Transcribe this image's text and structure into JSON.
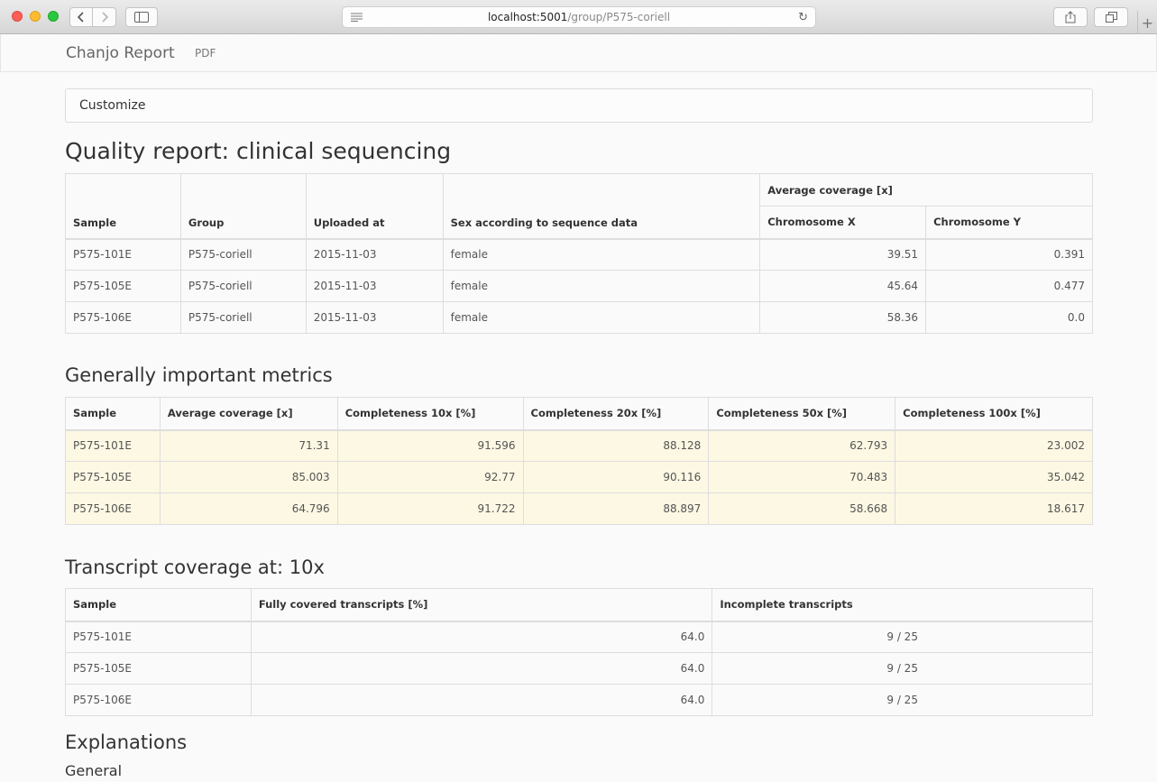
{
  "browser": {
    "address_host": "localhost:5001",
    "address_path": "/group/P575-coriell",
    "icons": [
      "back-icon",
      "forward-icon",
      "sidebar-icon",
      "reader-icon",
      "reload-icon",
      "share-icon",
      "tabs-icon",
      "plus-icon"
    ]
  },
  "navbar": {
    "brand": "Chanjo Report",
    "pdf_link": "PDF"
  },
  "customize": {
    "label": "Customize"
  },
  "quality": {
    "title": "Quality report: clinical sequencing",
    "group_header": "Average coverage [x]",
    "columns": [
      "Sample",
      "Group",
      "Uploaded at",
      "Sex according to sequence data",
      "Chromosome X",
      "Chromosome Y"
    ],
    "rows": [
      [
        "P575-101E",
        "P575-coriell",
        "2015-11-03",
        "female",
        "39.51",
        "0.391"
      ],
      [
        "P575-105E",
        "P575-coriell",
        "2015-11-03",
        "female",
        "45.64",
        "0.477"
      ],
      [
        "P575-106E",
        "P575-coriell",
        "2015-11-03",
        "female",
        "58.36",
        "0.0"
      ]
    ]
  },
  "metrics": {
    "title": "Generally important metrics",
    "columns": [
      "Sample",
      "Average coverage [x]",
      "Completeness 10x [%]",
      "Completeness 20x [%]",
      "Completeness 50x [%]",
      "Completeness 100x [%]"
    ],
    "rows": [
      [
        "P575-101E",
        "71.31",
        "91.596",
        "88.128",
        "62.793",
        "23.002"
      ],
      [
        "P575-105E",
        "85.003",
        "92.77",
        "90.116",
        "70.483",
        "35.042"
      ],
      [
        "P575-106E",
        "64.796",
        "91.722",
        "88.897",
        "58.668",
        "18.617"
      ]
    ],
    "highlight_color": "#fcf8e3"
  },
  "transcripts": {
    "title": "Transcript coverage at: 10x",
    "columns": [
      "Sample",
      "Fully covered transcripts [%]",
      "Incomplete transcripts"
    ],
    "rows": [
      [
        "P575-101E",
        "64.0",
        "9 / 25"
      ],
      [
        "P575-105E",
        "64.0",
        "9 / 25"
      ],
      [
        "P575-106E",
        "64.0",
        "9 / 25"
      ]
    ]
  },
  "explanations": {
    "title": "Explanations",
    "subtitle": "General"
  }
}
